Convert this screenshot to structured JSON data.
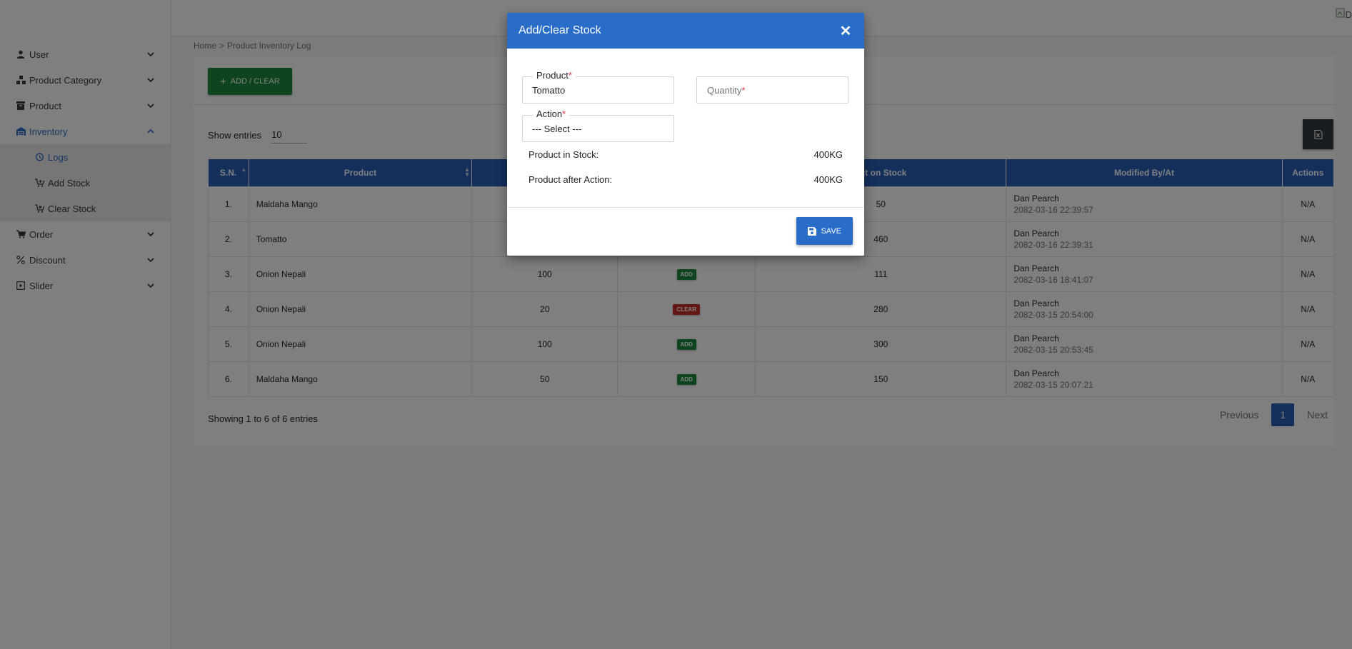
{
  "topbar": {
    "broken_image_alt": "D"
  },
  "sidebar": {
    "items": [
      {
        "label": "User",
        "icon": "user-icon"
      },
      {
        "label": "Product Category",
        "icon": "category-icon"
      },
      {
        "label": "Product",
        "icon": "box-icon"
      },
      {
        "label": "Inventory",
        "icon": "warehouse-icon",
        "expanded": true
      },
      {
        "label": "Order",
        "icon": "cart-icon"
      },
      {
        "label": "Discount",
        "icon": "percent-icon"
      },
      {
        "label": "Slider",
        "icon": "slider-icon"
      }
    ],
    "inventory_sub": [
      {
        "label": "Logs",
        "icon": "history-icon"
      },
      {
        "label": "Add Stock",
        "icon": "cart-add-icon"
      },
      {
        "label": "Clear Stock",
        "icon": "cart-remove-icon"
      }
    ]
  },
  "breadcrumb": {
    "home": "Home",
    "sep": ">",
    "current": "Product Inventory Log"
  },
  "toolbar": {
    "add_clear_label": "ADD / CLEAR"
  },
  "list": {
    "show_entries_label": "Show entries",
    "page_size": "10"
  },
  "table": {
    "headers": {
      "sn": "S.N.",
      "product": "Product",
      "stock": "uct on Stock",
      "modified": "Modified By/At",
      "actions": "Actions"
    },
    "rows": [
      {
        "sn": "1.",
        "product": "Maldaha Mango",
        "qty": "",
        "action": "",
        "stock": "50",
        "by": "Dan Pearch",
        "at": "2082-03-16 22:39:57",
        "actions": "N/A"
      },
      {
        "sn": "2.",
        "product": "Tomatto",
        "qty": "",
        "action": "",
        "stock": "460",
        "by": "Dan Pearch",
        "at": "2082-03-16 22:39:31",
        "actions": "N/A"
      },
      {
        "sn": "3.",
        "product": "Onion Nepali",
        "qty": "100",
        "action": "ADD",
        "stock": "111",
        "by": "Dan Pearch",
        "at": "2082-03-16 18:41:07",
        "actions": "N/A"
      },
      {
        "sn": "4.",
        "product": "Onion Nepali",
        "qty": "20",
        "action": "CLEAR",
        "stock": "280",
        "by": "Dan Pearch",
        "at": "2082-03-15 20:54:00",
        "actions": "N/A"
      },
      {
        "sn": "5.",
        "product": "Onion Nepali",
        "qty": "100",
        "action": "ADD",
        "stock": "300",
        "by": "Dan Pearch",
        "at": "2082-03-15 20:53:45",
        "actions": "N/A"
      },
      {
        "sn": "6.",
        "product": "Maldaha Mango",
        "qty": "50",
        "action": "ADD",
        "stock": "150",
        "by": "Dan Pearch",
        "at": "2082-03-15 20:07:21",
        "actions": "N/A"
      }
    ]
  },
  "pagination": {
    "info": "Showing 1 to 6 of 6 entries",
    "previous": "Previous",
    "current": "1",
    "next": "Next"
  },
  "modal": {
    "title": "Add/Clear Stock",
    "product_label": "Product",
    "product_value": "Tomatto",
    "quantity_placeholder": "Quantity",
    "action_label": "Action",
    "action_value": "--- Select ---",
    "required_mark": "*",
    "in_stock_label": "Product in Stock:",
    "in_stock_value": "400KG",
    "after_action_label": "Product after Action:",
    "after_action_value": "400KG",
    "save_label": "SAVE"
  },
  "colors": {
    "primary": "#2a6dc9",
    "header_blue": "#2a5eb8",
    "success": "#1f8a3c",
    "danger": "#c9302c"
  }
}
